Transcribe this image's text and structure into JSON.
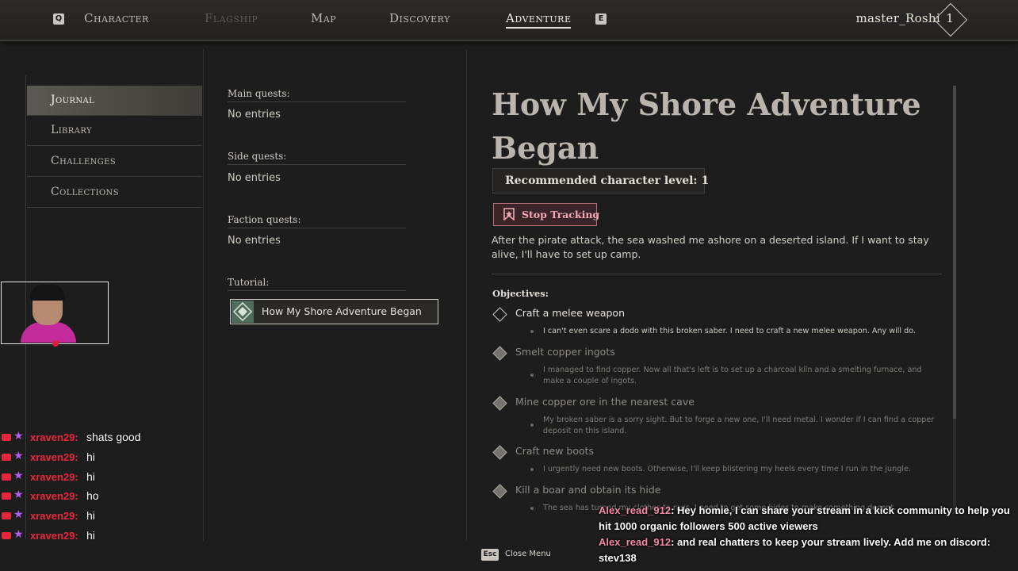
{
  "topbar": {
    "key_left": "Q",
    "key_right": "E",
    "tabs": [
      {
        "label": "Character",
        "state": "normal"
      },
      {
        "label": "Flagship",
        "state": "disabled"
      },
      {
        "label": "Map",
        "state": "normal"
      },
      {
        "label": "Discovery",
        "state": "normal"
      },
      {
        "label": "Adventure",
        "state": "active"
      }
    ],
    "username": "master_Roshi",
    "level": "1"
  },
  "sidebar": {
    "items": [
      {
        "label": "Journal",
        "active": true
      },
      {
        "label": "Library",
        "active": false
      },
      {
        "label": "Challenges",
        "active": false
      },
      {
        "label": "Collections",
        "active": false
      }
    ]
  },
  "quests": {
    "main_heading": "Main quests:",
    "main_empty": "No entries",
    "side_heading": "Side quests:",
    "side_empty": "No entries",
    "faction_heading": "Faction quests:",
    "faction_empty": "No entries",
    "tutorial_heading": "Tutorial:",
    "tutorial_entry": "How My Shore Adventure Began"
  },
  "details": {
    "title": "How My Shore Adventure Began",
    "recommended_level": "Recommended character level: 1",
    "stop_tracking": "Stop Tracking",
    "description": "After the pirate attack, the sea washed me ashore on a deserted island. If I want to stay alive, I'll have to set up camp.",
    "objectives_heading": "Objectives:",
    "objectives": [
      {
        "title": "Craft a melee weapon",
        "text": "I can't even scare a dodo with this broken saber. I need to craft a new melee weapon. Any will do.",
        "done": false
      },
      {
        "title": "Smelt copper ingots",
        "text": "I managed to find copper. Now all that's left is to set up a charcoal kiln and a smelting furnace, and make a couple of ingots.",
        "done": true
      },
      {
        "title": "Mine copper ore in the nearest cave",
        "text": "My broken saber is a sorry sight. But to forge a new one, I'll need metal. I wonder if I can find a copper deposit on this island.",
        "done": true
      },
      {
        "title": "Craft new boots",
        "text": "I urgently need new boots. Otherwise, I'll keep blistering my heels every time I run in the jungle.",
        "done": true
      },
      {
        "title": "Kill a boar and obtain its hide",
        "text": "The sea has turned my clothes to rags. I need to get some hides to make something decent.",
        "done": true
      }
    ]
  },
  "footer": {
    "esc_key": "Esc",
    "close_label": "Close Menu"
  },
  "stream_chat": [
    {
      "user": "xraven29:",
      "message": "shats good"
    },
    {
      "user": "xraven29:",
      "message": "hi"
    },
    {
      "user": "xraven29:",
      "message": "hi"
    },
    {
      "user": "xraven29:",
      "message": "ho"
    },
    {
      "user": "xraven29:",
      "message": "hi"
    },
    {
      "user": "xraven29:",
      "message": "hi"
    }
  ],
  "overlay_chat": [
    {
      "user": "Alex_read_912",
      "message": ": Hey homie, I can share your stream in a kick community to help you hit 1000 organic followers 500 active viewers"
    },
    {
      "user": "Alex_read_912",
      "message": ": and real chatters to keep your stream lively. Add me on discord: stev138"
    }
  ],
  "colors": {
    "background": "#1d1d1d",
    "accent_pink": "#f0a9b5",
    "chat_username": "#e8283d"
  }
}
